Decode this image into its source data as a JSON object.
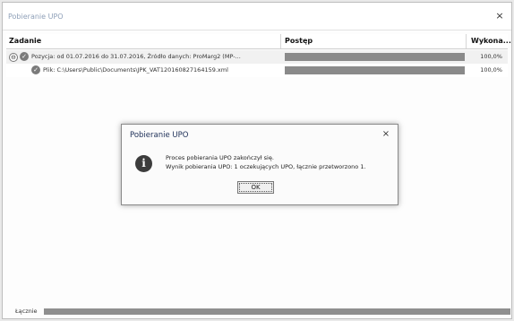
{
  "window": {
    "title": "Pobieranie UPO",
    "close_glyph": "×"
  },
  "grid": {
    "columns": [
      "Zadanie",
      "Postęp",
      "Wykona..."
    ],
    "rows": [
      {
        "expander": "⊖",
        "icon": "check-circle-icon",
        "text": "Pozycja: od 01.07.2016 do 31.07.2016, Źródło danych: ProMarg2 (MP-...",
        "progress_percent": 100,
        "done": "100,0%"
      },
      {
        "icon": "check-circle-icon",
        "text": "Plik: C:\\Users\\Public\\Documents\\JPK_VAT120160827164159.xml",
        "progress_percent": 100,
        "done": "100,0%"
      }
    ]
  },
  "dialog": {
    "title": "Pobieranie UPO",
    "close_glyph": "×",
    "icon": "info-icon",
    "line1": "Proces pobierania UPO zakończył się.",
    "line2": "Wynik pobierania UPO: 1 oczekujących UPO, łącznie przetworzono 1.",
    "ok_label": "OK"
  },
  "footer": {
    "label": "Łącznie",
    "progress_percent": 100
  }
}
